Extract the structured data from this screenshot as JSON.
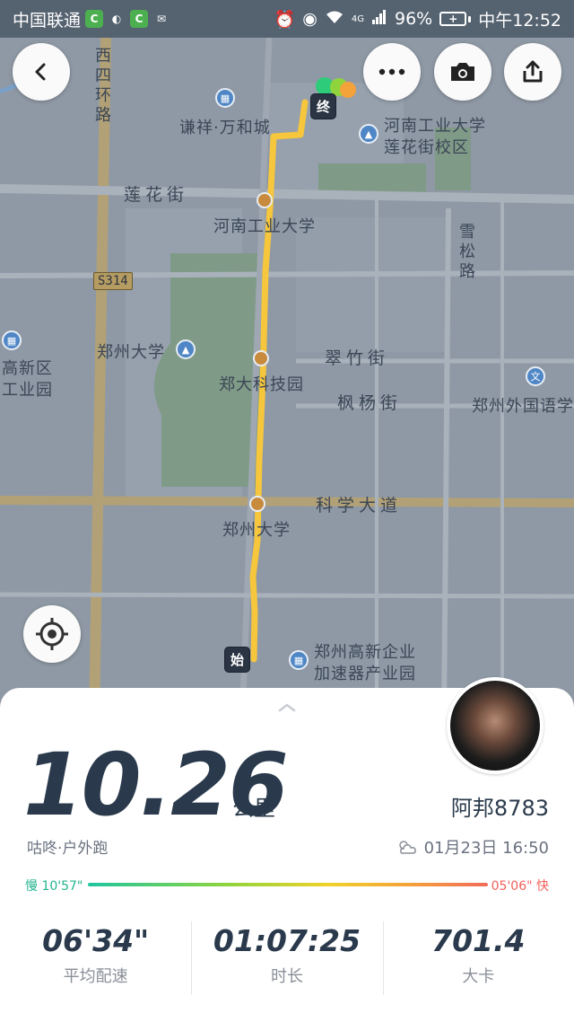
{
  "status_bar": {
    "carrier": "中国联通",
    "network": "4G",
    "battery": "96%",
    "time": "中午12:52"
  },
  "map": {
    "labels": {
      "west_4th_ring": "西四环路",
      "qianxiang": "谦祥·万和城",
      "henan_univ_campus_1": "河南工业大学",
      "henan_univ_campus_2": "莲花街校区",
      "lianhua_st": "莲花街",
      "henan_univ": "河南工业大学",
      "xuesong_rd": "雪松路",
      "s314": "S314",
      "zhengzhou_univ": "郑州大学",
      "gaoxin_1": "高新区",
      "gaoxin_2": "工业园",
      "cuizhu_st": "翠竹街",
      "zhengda_park": "郑大科技园",
      "fengyang_st": "枫杨街",
      "foreign_lang_school": "郑州外国语学",
      "kexue_ave": "科学大道",
      "zhengzhou_univ_station": "郑州大学",
      "incubator_1": "郑州高新企业",
      "incubator_2": "加速器产业园"
    },
    "start_marker": "始",
    "end_marker": "终"
  },
  "controls": {
    "back_icon": "back-arrow",
    "more_icon": "more-dots",
    "camera_icon": "camera",
    "share_icon": "share",
    "locate_icon": "locate-crosshair"
  },
  "summary": {
    "distance": "10.26",
    "distance_unit": "公里",
    "username": "阿邦8783",
    "source": "咕咚·户外跑",
    "datetime": "01月23日 16:50",
    "pace_slow": "慢 10'57\"",
    "pace_fast": "05'06\" 快",
    "pace_colors": [
      "#1fc6a0",
      "#8fd43c",
      "#f0d22a",
      "#f4a23a",
      "#f26b5a"
    ]
  },
  "stats": [
    {
      "value": "06'34\"",
      "label": "平均配速"
    },
    {
      "value": "01:07:25",
      "label": "时长"
    },
    {
      "value": "701.4",
      "label": "大卡"
    }
  ]
}
